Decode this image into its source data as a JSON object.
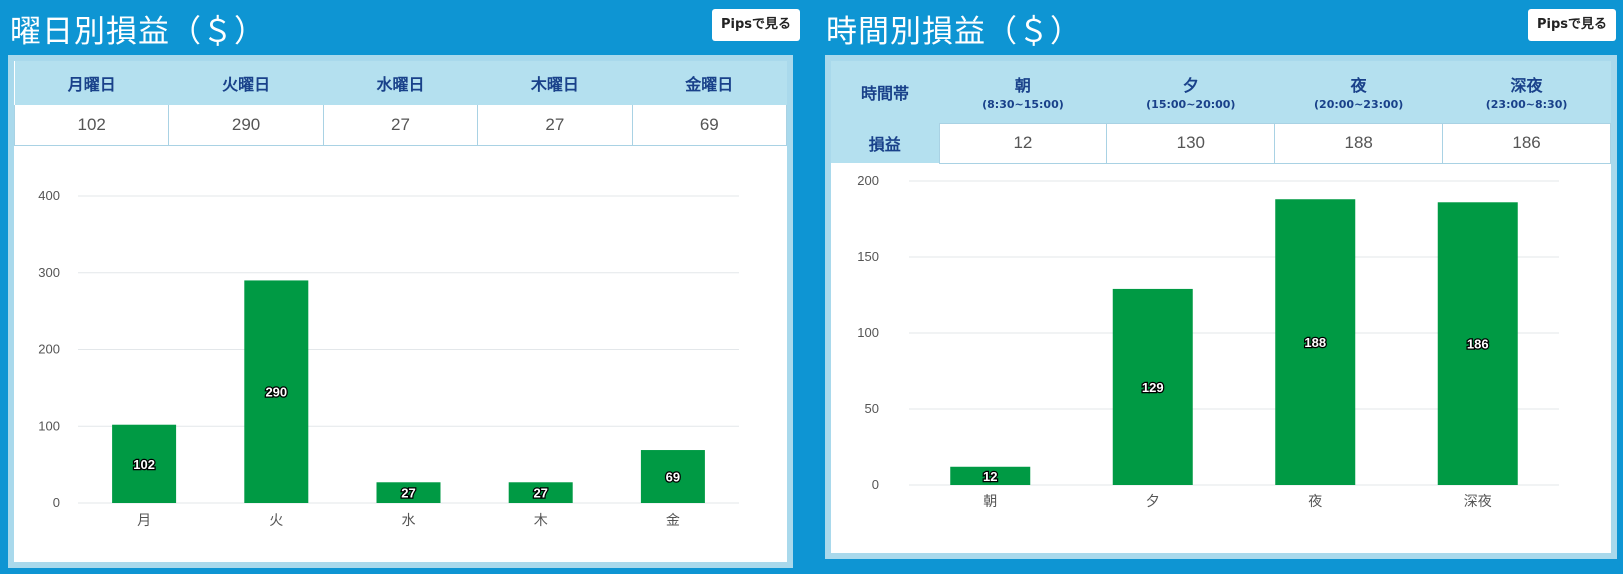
{
  "weekday_panel": {
    "title": "曜日別損益（＄）",
    "pips_button": "Pipsで見る",
    "headers": [
      "月曜日",
      "火曜日",
      "水曜日",
      "木曜日",
      "金曜日"
    ],
    "values": [
      "102",
      "290",
      "27",
      "27",
      "69"
    ]
  },
  "time_panel": {
    "title": "時間別損益（＄）",
    "pips_button": "Pipsで見る",
    "row_header_top": "時間帯",
    "row_header_values": "損益",
    "headers": [
      {
        "label": "朝",
        "range": "(8:30~15:00)"
      },
      {
        "label": "夕",
        "range": "(15:00~20:00)"
      },
      {
        "label": "夜",
        "range": "(20:00~23:00)"
      },
      {
        "label": "深夜",
        "range": "(23:00~8:30)"
      }
    ],
    "values": [
      "12",
      "130",
      "188",
      "186"
    ]
  },
  "chart_data": [
    {
      "type": "bar",
      "categories": [
        "月",
        "火",
        "水",
        "木",
        "金"
      ],
      "values": [
        102,
        290,
        27,
        27,
        69
      ],
      "data_labels": [
        "102",
        "290",
        "27",
        "27",
        "69"
      ],
      "ylim": [
        0,
        400
      ],
      "yticks": [
        0,
        100,
        200,
        300,
        400
      ],
      "grid": true,
      "color": "#009a44"
    },
    {
      "type": "bar",
      "categories": [
        "朝",
        "夕",
        "夜",
        "深夜"
      ],
      "values": [
        12,
        129,
        188,
        186
      ],
      "data_labels": [
        "12",
        "129",
        "188",
        "186"
      ],
      "ylim": [
        0,
        200
      ],
      "yticks": [
        0,
        50,
        100,
        150,
        200
      ],
      "grid": true,
      "color": "#009a44"
    }
  ]
}
